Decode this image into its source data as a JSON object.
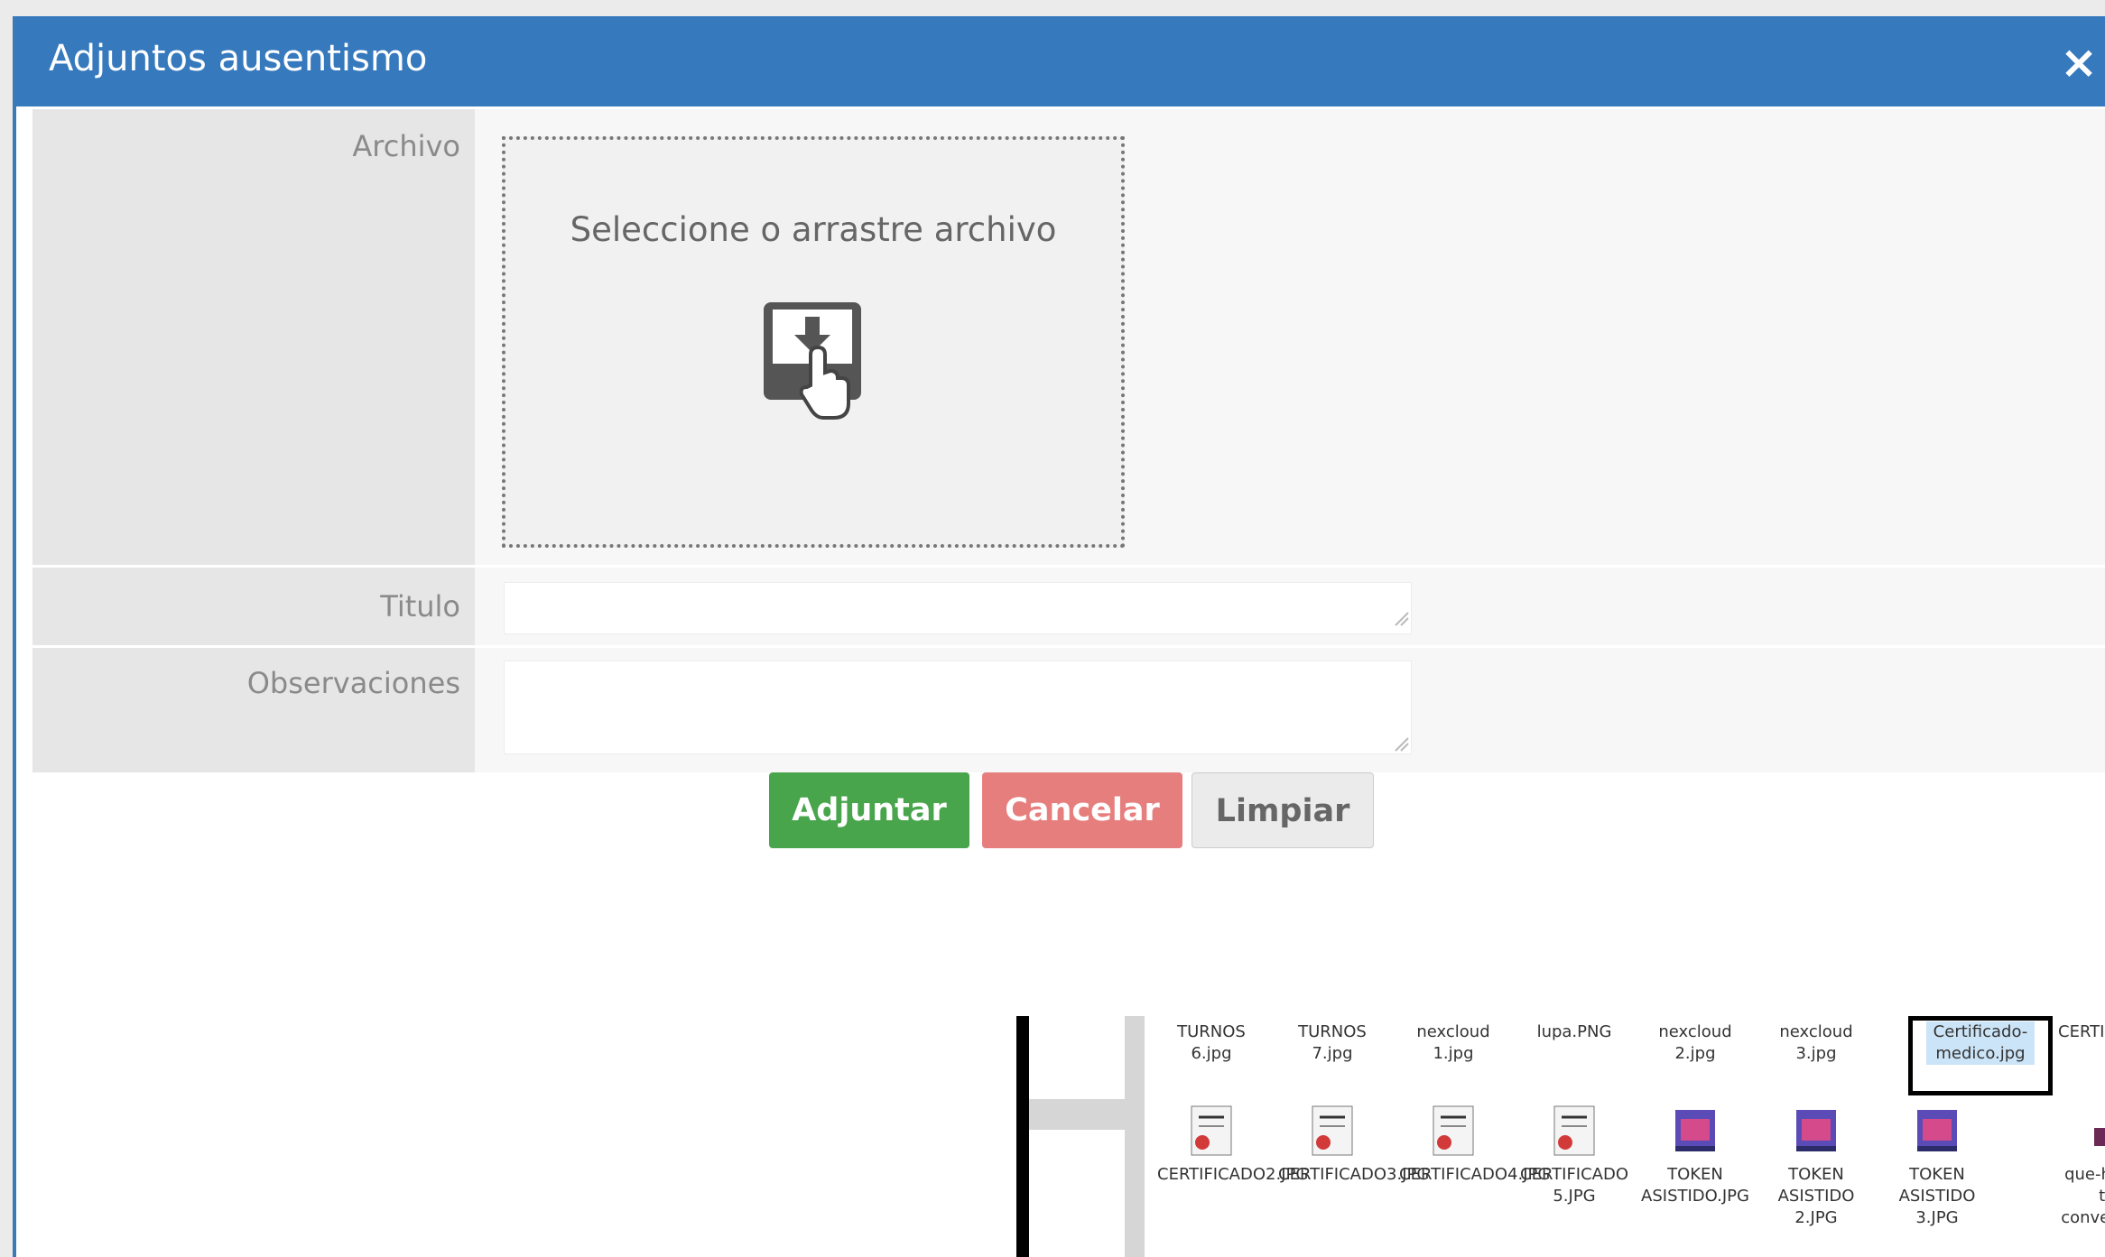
{
  "dialog": {
    "title": "Adjuntos ausentismo",
    "close_label": "×"
  },
  "form": {
    "archivo_label": "Archivo",
    "dropzone_text": "Seleccione o arrastre archivo",
    "titulo_label": "Titulo",
    "titulo_value": "",
    "observaciones_label": "Observaciones",
    "observaciones_value": ""
  },
  "buttons": {
    "adjuntar": "Adjuntar",
    "cancelar": "Cancelar",
    "limpiar": "Limpiar"
  },
  "colors": {
    "titlebar": "#3679bd",
    "adjuntar": "#48a54c",
    "cancelar": "#e77e7e",
    "limpiar": "#ebebeb"
  },
  "explorer": {
    "row1": [
      {
        "name": "TURNOS 6.jpg",
        "icon": "image-file-icon"
      },
      {
        "name": "TURNOS 7.jpg",
        "icon": "image-file-icon"
      },
      {
        "name": "nexcloud 1.jpg",
        "icon": "image-file-icon"
      },
      {
        "name": "lupa.PNG",
        "icon": "image-file-icon"
      },
      {
        "name": "nexcloud 2.jpg",
        "icon": "image-file-icon"
      },
      {
        "name": "nexcloud 3.jpg",
        "icon": "image-file-icon"
      },
      {
        "name": "Certificado-medico.jpg",
        "icon": "image-file-icon",
        "selected": true
      },
      {
        "name": "CERTIFICADO.JPG",
        "icon": "image-file-icon"
      }
    ],
    "row2": [
      {
        "name": "CERTIFICADO2.JPG",
        "icon": "certificate-file-icon"
      },
      {
        "name": "CERTIFICADO3.JPG",
        "icon": "certificate-file-icon"
      },
      {
        "name": "CERTIFICADO4.JPG",
        "icon": "certificate-file-icon"
      },
      {
        "name": "CERTIFICADO 5.JPG",
        "icon": "certificate-file-icon"
      },
      {
        "name": "TOKEN ASISTIDO.JPG",
        "icon": "token-file-icon"
      },
      {
        "name": "TOKEN ASISTIDO 2.JPG",
        "icon": "token-file-icon"
      },
      {
        "name": "TOKEN ASISTIDO 3.JPG",
        "icon": "token-file-icon"
      },
      {
        "name": "que-hoales-tie-convecon-os",
        "icon": "image-file-icon"
      }
    ]
  }
}
